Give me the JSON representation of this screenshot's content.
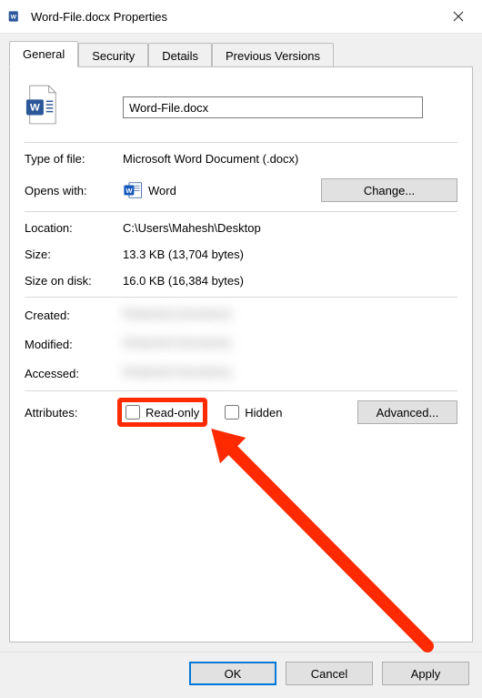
{
  "titlebar": {
    "title": "Word-File.docx Properties"
  },
  "tabs": {
    "general": "General",
    "security": "Security",
    "details": "Details",
    "previous_versions": "Previous Versions"
  },
  "general": {
    "filename": "Word-File.docx",
    "type_label": "Type of file:",
    "type_value": "Microsoft Word Document (.docx)",
    "opens_label": "Opens with:",
    "opens_value": "Word",
    "change_btn": "Change...",
    "location_label": "Location:",
    "location_value": "C:\\Users\\Mahesh\\Desktop",
    "size_label": "Size:",
    "size_value": "13.3 KB (13,704 bytes)",
    "disk_label": "Size on disk:",
    "disk_value": "16.0 KB (16,384 bytes)",
    "created_label": "Created:",
    "modified_label": "Modified:",
    "accessed_label": "Accessed:",
    "attributes_label": "Attributes:",
    "readonly_label": "Read-only",
    "hidden_label": "Hidden",
    "advanced_btn": "Advanced..."
  },
  "buttons": {
    "ok": "OK",
    "cancel": "Cancel",
    "apply": "Apply"
  }
}
